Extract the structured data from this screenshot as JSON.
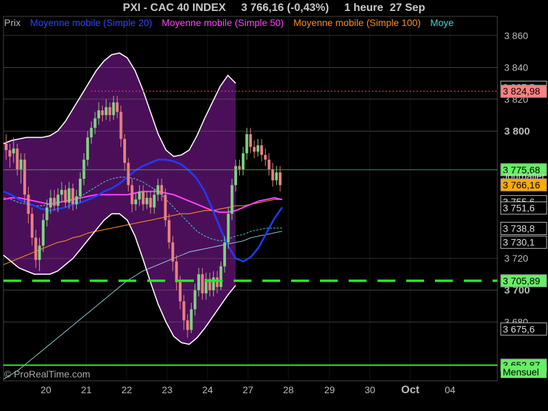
{
  "header": {
    "symbol": "PXI - CAC 40 INDEX",
    "quote": "3 766,16 (-0,43%)",
    "period": "1 heure",
    "date": "27 Sep"
  },
  "legend": {
    "prix": "Prix",
    "ma20": "Moyenne mobile (Simple 20)",
    "ma50": "Moyenne mobile (Simple 50)",
    "ma100": "Moyenne mobile (Simple 100)",
    "ma_more": "Moye"
  },
  "watermark": "© ProRealTime.com",
  "colors": {
    "background": "#000000",
    "band_fill": "#4b0f5a",
    "band_line": "#ffffff",
    "candle_up": "#7fd27f",
    "candle_down": "#e88080",
    "ma20": "#1f3cff",
    "ma50": "#ff44ff",
    "ma100": "#ff8c1a",
    "ma200": "#9adfe8",
    "dotted_teal": "#40d8d8",
    "support": "#22ee22",
    "resistance": "#e83030",
    "grid": "#666666",
    "tag_green": "#66ee66",
    "tag_orange": "#ffaa00",
    "tag_red": "#ff8080"
  },
  "chart_data": {
    "type": "line",
    "title": "PXI - CAC 40 INDEX",
    "ylim": [
      3643,
      3872
    ],
    "yticks": [
      {
        "v": 3860,
        "label": "3 860",
        "bold": false
      },
      {
        "v": 3840,
        "label": "3 840",
        "bold": false
      },
      {
        "v": 3820,
        "label": "3 820",
        "bold": false
      },
      {
        "v": 3800,
        "label": "3 800",
        "bold": true
      },
      {
        "v": 3720,
        "label": "3 720",
        "bold": false
      },
      {
        "v": 3700,
        "label": "3 700",
        "bold": true
      },
      {
        "v": 3680,
        "label": "3 680",
        "bold": false
      }
    ],
    "xticks": [
      {
        "label": "20",
        "bold": false
      },
      {
        "label": "21",
        "bold": false
      },
      {
        "label": "22",
        "bold": false
      },
      {
        "label": "23",
        "bold": false
      },
      {
        "label": "24",
        "bold": false
      },
      {
        "label": "27",
        "bold": false
      },
      {
        "label": "28",
        "bold": false
      },
      {
        "label": "29",
        "bold": false
      },
      {
        "label": "30",
        "bold": false
      },
      {
        "label": "Oct",
        "bold": true
      },
      {
        "label": "04",
        "bold": false
      }
    ],
    "candles": [
      [
        3792,
        3788,
        3798,
        3782
      ],
      [
        3788,
        3784,
        3792,
        3777
      ],
      [
        3786,
        3789,
        3796,
        3780
      ],
      [
        3789,
        3776,
        3792,
        3772
      ],
      [
        3776,
        3782,
        3786,
        3767
      ],
      [
        3782,
        3760,
        3786,
        3755
      ],
      [
        3760,
        3748,
        3765,
        3742
      ],
      [
        3748,
        3733,
        3752,
        3728
      ],
      [
        3733,
        3719,
        3738,
        3714
      ],
      [
        3719,
        3728,
        3733,
        3712
      ],
      [
        3728,
        3744,
        3748,
        3724
      ],
      [
        3744,
        3752,
        3757,
        3740
      ],
      [
        3752,
        3758,
        3763,
        3748
      ],
      [
        3758,
        3753,
        3763,
        3750
      ],
      [
        3753,
        3760,
        3764,
        3749
      ],
      [
        3760,
        3763,
        3768,
        3755
      ],
      [
        3763,
        3755,
        3766,
        3752
      ],
      [
        3755,
        3764,
        3768,
        3751
      ],
      [
        3764,
        3754,
        3767,
        3750
      ],
      [
        3754,
        3759,
        3763,
        3751
      ],
      [
        3759,
        3770,
        3774,
        3755
      ],
      [
        3770,
        3782,
        3786,
        3766
      ],
      [
        3782,
        3796,
        3800,
        3778
      ],
      [
        3796,
        3802,
        3806,
        3792
      ],
      [
        3802,
        3808,
        3812,
        3798
      ],
      [
        3808,
        3813,
        3818,
        3804
      ],
      [
        3813,
        3810,
        3816,
        3806
      ],
      [
        3810,
        3815,
        3820,
        3807
      ],
      [
        3815,
        3810,
        3818,
        3806
      ],
      [
        3810,
        3818,
        3822,
        3807
      ],
      [
        3818,
        3812,
        3822,
        3808
      ],
      [
        3812,
        3795,
        3816,
        3790
      ],
      [
        3795,
        3780,
        3798,
        3775
      ],
      [
        3780,
        3766,
        3783,
        3762
      ],
      [
        3766,
        3754,
        3770,
        3749
      ],
      [
        3754,
        3757,
        3761,
        3750
      ],
      [
        3757,
        3762,
        3766,
        3753
      ],
      [
        3762,
        3754,
        3766,
        3750
      ],
      [
        3754,
        3758,
        3762,
        3751
      ],
      [
        3758,
        3752,
        3762,
        3748
      ],
      [
        3752,
        3760,
        3764,
        3748
      ],
      [
        3760,
        3766,
        3770,
        3756
      ],
      [
        3766,
        3760,
        3770,
        3756
      ],
      [
        3760,
        3744,
        3764,
        3740
      ],
      [
        3744,
        3730,
        3748,
        3726
      ],
      [
        3730,
        3718,
        3734,
        3712
      ],
      [
        3718,
        3705,
        3722,
        3700
      ],
      [
        3705,
        3693,
        3709,
        3688
      ],
      [
        3693,
        3681,
        3697,
        3675
      ],
      [
        3681,
        3675,
        3685,
        3670
      ],
      [
        3675,
        3688,
        3692,
        3673
      ],
      [
        3688,
        3700,
        3704,
        3684
      ],
      [
        3700,
        3710,
        3714,
        3696
      ],
      [
        3710,
        3698,
        3714,
        3694
      ],
      [
        3698,
        3707,
        3711,
        3694
      ],
      [
        3707,
        3700,
        3711,
        3696
      ],
      [
        3700,
        3708,
        3712,
        3696
      ],
      [
        3708,
        3702,
        3712,
        3698
      ],
      [
        3702,
        3715,
        3718,
        3700
      ],
      [
        3715,
        3730,
        3734,
        3711
      ],
      [
        3730,
        3748,
        3752,
        3726
      ],
      [
        3748,
        3766,
        3770,
        3744
      ],
      [
        3766,
        3778,
        3782,
        3762
      ],
      [
        3778,
        3776,
        3782,
        3772
      ],
      [
        3776,
        3786,
        3790,
        3772
      ],
      [
        3786,
        3798,
        3802,
        3782
      ],
      [
        3798,
        3790,
        3802,
        3786
      ],
      [
        3790,
        3787,
        3794,
        3783
      ],
      [
        3787,
        3791,
        3795,
        3784
      ],
      [
        3791,
        3785,
        3795,
        3781
      ],
      [
        3785,
        3782,
        3789,
        3778
      ],
      [
        3782,
        3776,
        3786,
        3772
      ],
      [
        3776,
        3769,
        3780,
        3765
      ],
      [
        3769,
        3774,
        3778,
        3766
      ],
      [
        3774,
        3766,
        3778,
        3762
      ]
    ],
    "series": [
      {
        "name": "Moyenne mobile (Simple 20)",
        "values": [
          3762,
          3760,
          3757,
          3755,
          3753,
          3751,
          3750,
          3751,
          3752,
          3754,
          3755,
          3757,
          3759,
          3762,
          3764,
          3767,
          3771,
          3775,
          3778,
          3780,
          3782,
          3782,
          3781,
          3779,
          3775,
          3770,
          3762,
          3751,
          3739,
          3728,
          3720,
          3718,
          3721,
          3727,
          3736,
          3745,
          3752
        ]
      },
      {
        "name": "Moyenne mobile (Simple 50)",
        "values": [
          3757,
          3758,
          3758,
          3757,
          3756,
          3755,
          3754,
          3755,
          3756,
          3757,
          3758,
          3759,
          3760,
          3760,
          3760,
          3760,
          3760,
          3761,
          3762,
          3762,
          3762,
          3761,
          3760,
          3758,
          3756,
          3754,
          3752,
          3750,
          3749,
          3749,
          3750,
          3752,
          3754,
          3756,
          3757,
          3758,
          3757
        ]
      },
      {
        "name": "Moyenne mobile (Simple 100)",
        "values": [
          3716,
          3718,
          3720,
          3722,
          3724,
          3726,
          3728,
          3730,
          3731,
          3733,
          3734,
          3736,
          3737,
          3738,
          3739,
          3740,
          3741,
          3742,
          3743,
          3744,
          3745,
          3746,
          3747,
          3748,
          3748,
          3749,
          3750,
          3750,
          3751,
          3752,
          3753,
          3753,
          3754,
          3755,
          3756,
          3757,
          3757
        ]
      },
      {
        "name": "Moye",
        "values": [
          3644,
          3647,
          3650,
          3654,
          3658,
          3662,
          3666,
          3670,
          3674,
          3678,
          3682,
          3686,
          3690,
          3694,
          3698,
          3702,
          3706,
          3709,
          3712,
          3714,
          3716,
          3718,
          3720,
          3722,
          3724,
          3725,
          3726,
          3727,
          3728,
          3729,
          3730,
          3731,
          3733,
          3734,
          3735,
          3736,
          3737
        ]
      },
      {
        "values": [
          3758,
          3757,
          3755,
          3754,
          3753,
          3753,
          3754,
          3755,
          3756,
          3757,
          3759,
          3762,
          3765,
          3768,
          3770,
          3771,
          3771,
          3770,
          3768,
          3765,
          3762,
          3757,
          3752,
          3747,
          3742,
          3737,
          3734,
          3732,
          3731,
          3732,
          3734,
          3735,
          3737,
          3738,
          3739,
          3739,
          3739
        ]
      },
      {
        "values": [
          3792,
          3794,
          3795,
          3796,
          3796,
          3796,
          3797,
          3800,
          3806,
          3814,
          3822,
          3830,
          3838,
          3844,
          3848,
          3849,
          3846,
          3838,
          3826,
          3812,
          3798,
          3788,
          3784,
          3785,
          3788,
          3797,
          3808,
          3818,
          3828,
          3835,
          3830
        ]
      },
      {
        "values": [
          3722,
          3718,
          3714,
          3712,
          3710,
          3710,
          3710,
          3712,
          3716,
          3720,
          3726,
          3732,
          3738,
          3744,
          3748,
          3748,
          3744,
          3734,
          3720,
          3705,
          3691,
          3680,
          3671,
          3667,
          3666,
          3670,
          3676,
          3683,
          3690,
          3697,
          3703
        ]
      }
    ],
    "lines": [
      {
        "value": 3824.98,
        "style": "dotted-red"
      },
      {
        "value": 3775.68,
        "style": "solid-green-thin"
      },
      {
        "value": 3705.89,
        "style": "dashed-green-thick"
      },
      {
        "value": 3652.87,
        "style": "solid-green"
      }
    ],
    "price_tags": [
      {
        "label": "3 827,5",
        "value": 3827.5,
        "kind": "black"
      },
      {
        "label": "3 824,98",
        "value": 3824.98,
        "kind": "red"
      },
      {
        "label": "3 775,68",
        "value": 3775.68,
        "kind": "green"
      },
      {
        "label": "Journalier",
        "value": 3771.8,
        "kind": "plain"
      },
      {
        "label": "3 766,16",
        "value": 3766.16,
        "kind": "orange"
      },
      {
        "label": "3 755,6",
        "value": 3755.6,
        "kind": "black"
      },
      {
        "label": "3 751,6",
        "value": 3751.6,
        "kind": "black"
      },
      {
        "label": "3 738,8",
        "value": 3738.8,
        "kind": "black"
      },
      {
        "label": "3 730,1",
        "value": 3730.1,
        "kind": "black"
      },
      {
        "label": "3 705,89",
        "value": 3705.89,
        "kind": "green"
      },
      {
        "label": "3 675,6",
        "value": 3675.6,
        "kind": "black"
      },
      {
        "label": "3 652,87",
        "value": 3652.87,
        "kind": "green"
      },
      {
        "label": "Mensuel",
        "value": 3648.7,
        "kind": "plain"
      }
    ]
  }
}
